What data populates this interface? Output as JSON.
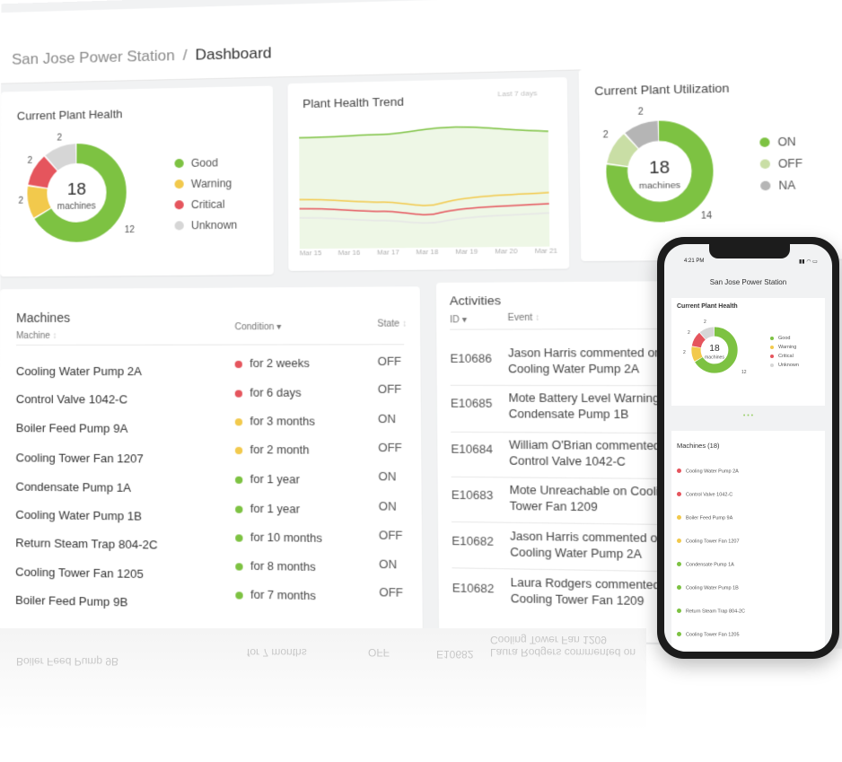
{
  "breadcrumb": {
    "site": "San Jose Power Station",
    "separator": "/",
    "page": "Dashboard"
  },
  "colors": {
    "good": "#7dc242",
    "warning": "#f2c94c",
    "critical": "#e5555d",
    "unknown": "#d6d6d6",
    "off": "#c9dea5",
    "na": "#b5b5b5"
  },
  "plant_health": {
    "title": "Current Plant Health",
    "center_number": "18",
    "center_label": "machines",
    "segments": [
      {
        "label": "Good",
        "value": 12,
        "color": "#7dc242"
      },
      {
        "label": "Warning",
        "value": 2,
        "color": "#f2c94c"
      },
      {
        "label": "Critical",
        "value": 2,
        "color": "#e5555d"
      },
      {
        "label": "Unknown",
        "value": 2,
        "color": "#d6d6d6"
      }
    ],
    "value_labels": {
      "good": "12",
      "warning": "2",
      "critical": "2",
      "unknown": "2"
    }
  },
  "trend": {
    "title": "Plant Health Trend",
    "range": "Last 7 days",
    "x_labels": [
      "Mar 15",
      "Mar 16",
      "Mar 17",
      "Mar 18",
      "Mar 19",
      "Mar 20",
      "Mar 21"
    ]
  },
  "utilization": {
    "title": "Current Plant Utilization",
    "center_number": "18",
    "center_label": "machines",
    "segments": [
      {
        "label": "ON",
        "value": 14,
        "color": "#7dc242"
      },
      {
        "label": "OFF",
        "value": 2,
        "color": "#c9dea5"
      },
      {
        "label": "NA",
        "value": 2,
        "color": "#b5b5b5"
      }
    ],
    "value_labels": {
      "on": "14",
      "off": "2",
      "na": "2"
    }
  },
  "machines": {
    "title": "Machines",
    "headers": {
      "machine": "Machine",
      "condition": "Condition",
      "state": "State"
    },
    "rows": [
      {
        "name": "Cooling Water Pump 2A",
        "condition": "for 2 weeks",
        "color": "#e5555d",
        "state": "OFF"
      },
      {
        "name": "Control Valve 1042-C",
        "condition": "for 6 days",
        "color": "#e5555d",
        "state": "OFF"
      },
      {
        "name": "Boiler Feed Pump 9A",
        "condition": "for 3 months",
        "color": "#f2c94c",
        "state": "ON"
      },
      {
        "name": "Cooling Tower Fan 1207",
        "condition": "for 2 month",
        "color": "#f2c94c",
        "state": "OFF"
      },
      {
        "name": "Condensate Pump 1A",
        "condition": "for 1 year",
        "color": "#7dc242",
        "state": "ON"
      },
      {
        "name": "Cooling Water Pump 1B",
        "condition": "for 1 year",
        "color": "#7dc242",
        "state": "ON"
      },
      {
        "name": "Return Steam Trap 804-2C",
        "condition": "for 10 months",
        "color": "#7dc242",
        "state": "OFF"
      },
      {
        "name": "Cooling Tower Fan 1205",
        "condition": "for 8 months",
        "color": "#7dc242",
        "state": "ON"
      },
      {
        "name": "Boiler Feed Pump 9B",
        "condition": "for 7 months",
        "color": "#7dc242",
        "state": "OFF"
      }
    ]
  },
  "activities": {
    "title": "Activities",
    "headers": {
      "id": "ID",
      "event": "Event"
    },
    "rows": [
      {
        "id": "E10686",
        "event": "Jason Harris commented on Cooling Water Pump 2A"
      },
      {
        "id": "E10685",
        "event": "Mote Battery Level Warning on Condensate Pump 1B"
      },
      {
        "id": "E10684",
        "event": "William O'Brian commented on Control Valve 1042-C"
      },
      {
        "id": "E10683",
        "event": "Mote Unreachable on Cooling Tower Fan 1209"
      },
      {
        "id": "E10682",
        "event": "Jason Harris commented on Cooling Water Pump 2A"
      },
      {
        "id": "E10682",
        "event": "Laura Rodgers commented on Cooling Tower Fan 1209"
      }
    ]
  },
  "phone": {
    "time": "4:21 PM",
    "title": "San Jose Power Station",
    "health_title": "Current Plant Health",
    "center_number": "18",
    "center_label": "machines",
    "legend": [
      "Good",
      "Warning",
      "Critical",
      "Unknown"
    ],
    "value_labels": {
      "good": "12",
      "warning": "2",
      "critical": "2",
      "unknown": "2"
    },
    "pager": "• • •",
    "machines_title": "Machines (18)",
    "machines": [
      {
        "name": "Cooling Water Pump 2A",
        "color": "#e5555d"
      },
      {
        "name": "Control Valve 1042-C",
        "color": "#e5555d"
      },
      {
        "name": "Boiler Feed Pump 9A",
        "color": "#f2c94c"
      },
      {
        "name": "Cooling Tower Fan 1207",
        "color": "#f2c94c"
      },
      {
        "name": "Condensate Pump 1A",
        "color": "#7dc242"
      },
      {
        "name": "Cooling Water Pump 1B",
        "color": "#7dc242"
      },
      {
        "name": "Return Steam Trap 804-2C",
        "color": "#7dc242"
      },
      {
        "name": "Cooling Tower Fan 1205",
        "color": "#7dc242"
      }
    ]
  }
}
